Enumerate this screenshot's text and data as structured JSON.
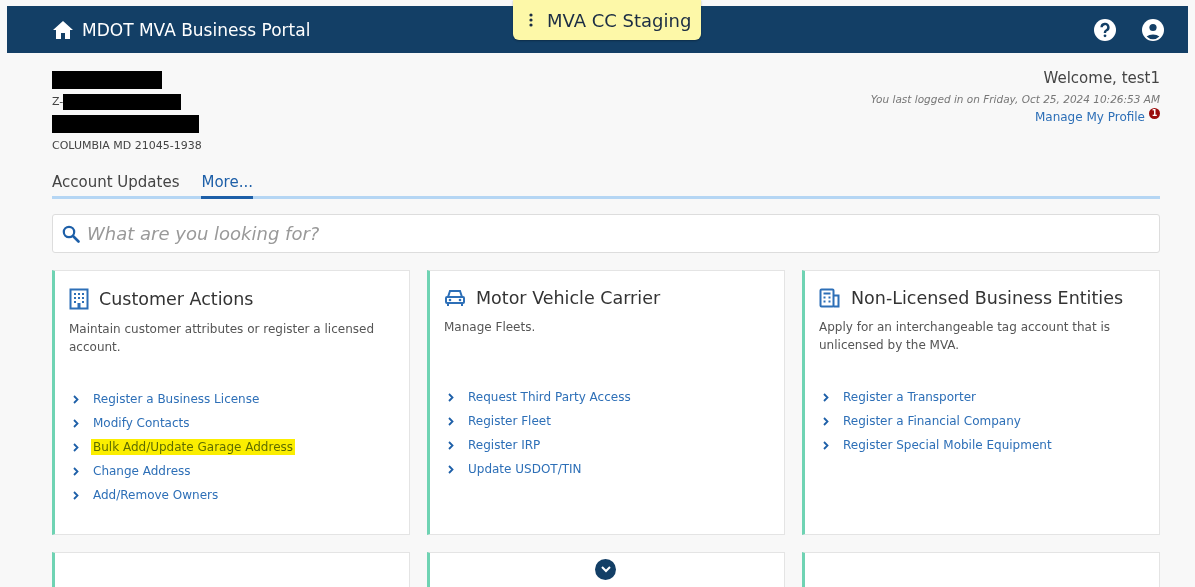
{
  "header": {
    "title": "MDOT MVA Business Portal",
    "environment": "MVA CC Staging"
  },
  "account": {
    "lines": [
      {
        "kind": "redacted"
      },
      {
        "kind": "prefixed",
        "text": "Z-"
      },
      {
        "kind": "redacted"
      },
      {
        "kind": "text",
        "text": "COLUMBIA MD 21045-1938"
      }
    ]
  },
  "welcome": {
    "greeting": "Welcome, test1",
    "last_login": "You last logged in on Friday, Oct 25, 2024 10:26:53 AM",
    "profile_link": "Manage My Profile",
    "notification_count": "1"
  },
  "tabs": [
    {
      "label": "Account Updates",
      "selected": false
    },
    {
      "label": "More...",
      "selected": true
    }
  ],
  "search": {
    "placeholder": "What are you looking for?"
  },
  "cards": [
    {
      "title": "Customer Actions",
      "description": "Maintain customer attributes or register a licensed account.",
      "links": [
        {
          "label": "Register a Business License",
          "highlighted": false
        },
        {
          "label": "Modify Contacts",
          "highlighted": false
        },
        {
          "label": "Bulk Add/Update Garage Address",
          "highlighted": true
        },
        {
          "label": "Change Address",
          "highlighted": false
        },
        {
          "label": "Add/Remove Owners",
          "highlighted": false
        }
      ]
    },
    {
      "title": "Motor Vehicle Carrier",
      "description": "Manage Fleets.",
      "links": [
        {
          "label": "Request Third Party Access",
          "highlighted": false
        },
        {
          "label": "Register Fleet",
          "highlighted": false
        },
        {
          "label": "Register IRP",
          "highlighted": false
        },
        {
          "label": "Update USDOT/TIN",
          "highlighted": false
        }
      ]
    },
    {
      "title": "Non-Licensed Business Entities",
      "description": "Apply for an interchangeable tag account that is unlicensed by the MVA.",
      "links": [
        {
          "label": "Register a Transporter",
          "highlighted": false
        },
        {
          "label": "Register a Financial Company",
          "highlighted": false
        },
        {
          "label": "Register Special Mobile Equipment",
          "highlighted": false
        }
      ]
    }
  ]
}
